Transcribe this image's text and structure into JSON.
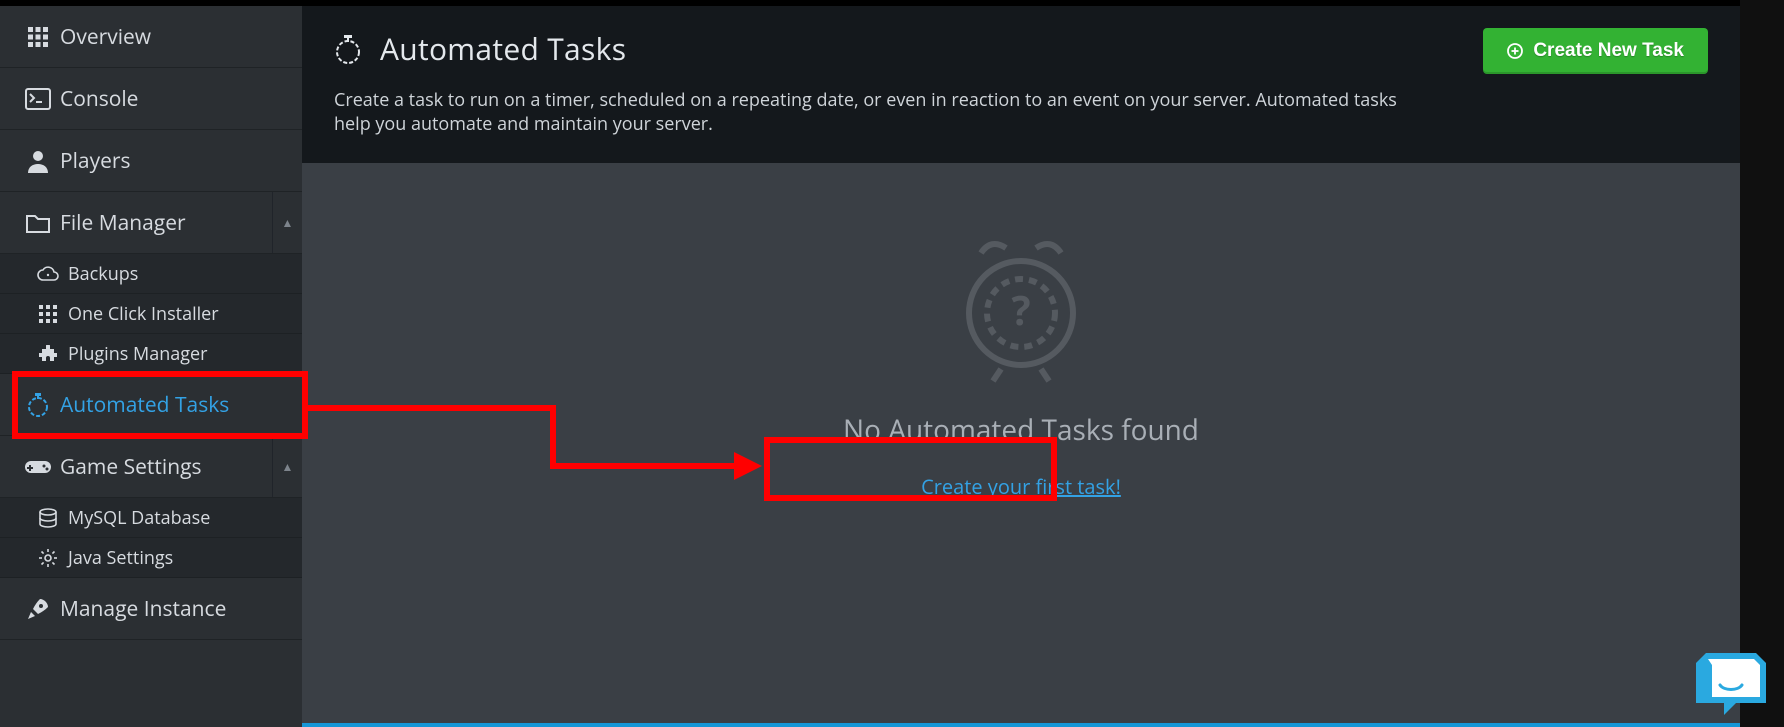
{
  "sidebar": {
    "items": [
      {
        "name": "overview",
        "label": "Overview"
      },
      {
        "name": "console",
        "label": "Console"
      },
      {
        "name": "players",
        "label": "Players"
      },
      {
        "name": "file-manager",
        "label": "File Manager",
        "expandable": true
      },
      {
        "name": "automated-tasks",
        "label": "Automated Tasks",
        "active": true
      },
      {
        "name": "game-settings",
        "label": "Game Settings",
        "expandable": true
      },
      {
        "name": "manage-instance",
        "label": "Manage Instance"
      }
    ],
    "file_manager_children": [
      {
        "name": "backups",
        "label": "Backups"
      },
      {
        "name": "one-click-installer",
        "label": "One Click Installer"
      },
      {
        "name": "plugins-manager",
        "label": "Plugins Manager"
      }
    ],
    "game_settings_children": [
      {
        "name": "mysql-database",
        "label": "MySQL Database"
      },
      {
        "name": "java-settings",
        "label": "Java Settings"
      }
    ]
  },
  "header": {
    "title": "Automated Tasks",
    "description": "Create a task to run on a timer, scheduled on a repeating date, or even in reaction to an event on your server. Automated tasks help you automate and maintain your server.",
    "create_button": "Create New Task"
  },
  "empty_state": {
    "title": "No Automated Tasks found",
    "link": "Create your first task!"
  },
  "colors": {
    "accent": "#33a2e5",
    "create_btn": "#33b233",
    "annotation": "#ff0000"
  }
}
